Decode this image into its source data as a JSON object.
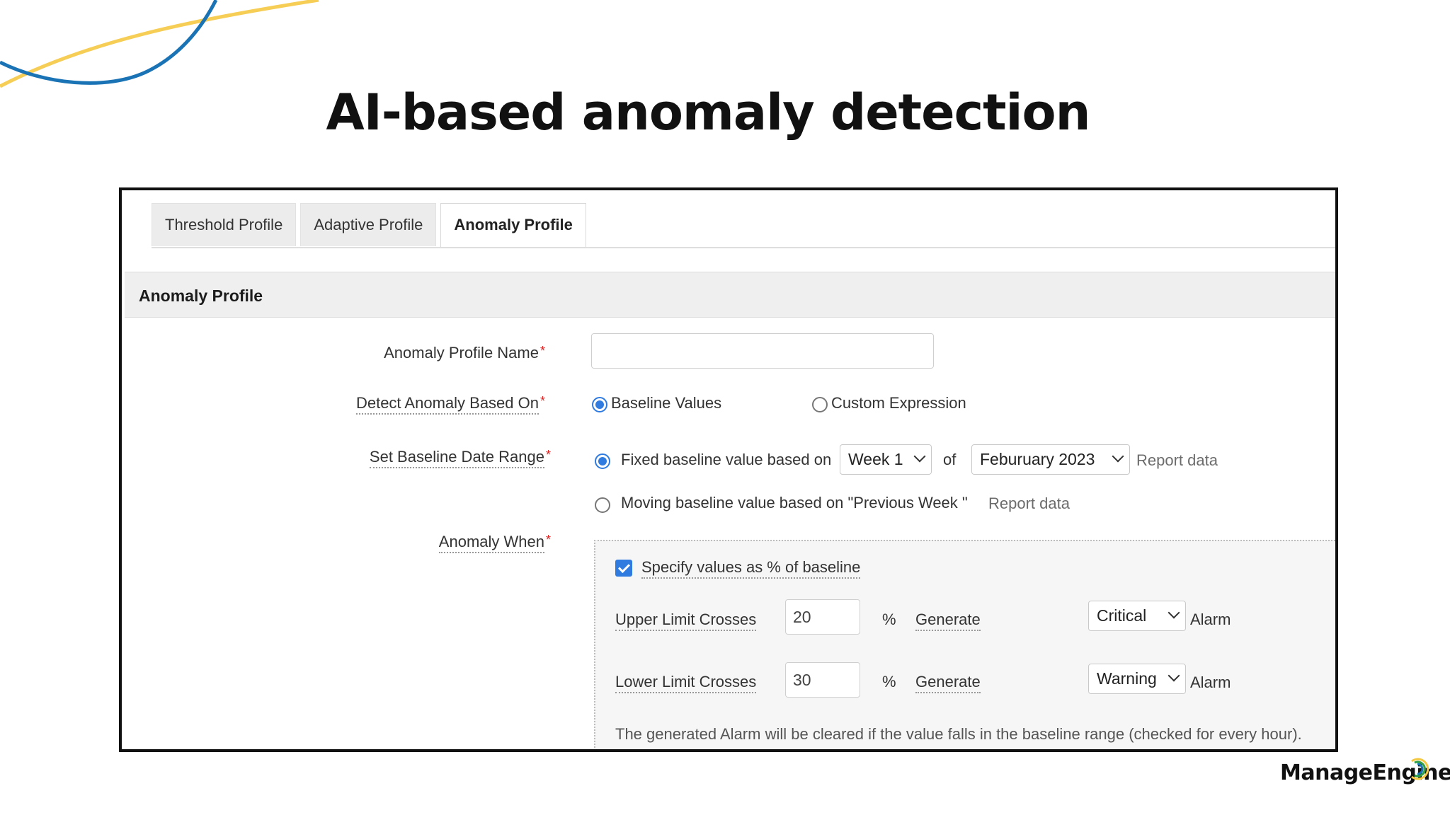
{
  "slide": {
    "title": "AI-based anomaly detection",
    "brand": "ManageEngine",
    "deco_colors": {
      "blue": "#1a73b5",
      "yellow": "#f5c842"
    }
  },
  "tabs": [
    {
      "label": "Threshold Profile",
      "active": false
    },
    {
      "label": "Adaptive Profile",
      "active": false
    },
    {
      "label": "Anomaly Profile",
      "active": true
    }
  ],
  "section": {
    "title": "Anomaly Profile"
  },
  "form": {
    "profile_name": {
      "label": "Anomaly Profile Name",
      "required": "*",
      "value": "",
      "placeholder": ""
    },
    "detect_based_on": {
      "label": "Detect Anomaly Based On",
      "required": "*",
      "options": [
        {
          "label": "Baseline Values",
          "checked": true
        },
        {
          "label": "Custom Expression",
          "checked": false
        }
      ]
    },
    "baseline_range": {
      "label": "Set Baseline Date Range",
      "required": "*",
      "fixed": {
        "checked": true,
        "prefix": "Fixed baseline value based on",
        "week": "Week 1",
        "of": "of",
        "month": "Feburuary 2023",
        "link": "Report data"
      },
      "moving": {
        "checked": false,
        "text": "Moving baseline value based on \"Previous Week \"",
        "link": "Report data"
      }
    },
    "anomaly_when": {
      "label": "Anomaly When",
      "required": "*",
      "percent_checkbox": {
        "label": "Specify values as % of baseline",
        "checked": true
      },
      "upper": {
        "label": "Upper Limit Crosses",
        "value": "20",
        "unit": "%",
        "generate": "Generate",
        "severity": "Critical",
        "suffix": "Alarm"
      },
      "lower": {
        "label": "Lower Limit Crosses",
        "value": "30",
        "unit": "%",
        "generate": "Generate",
        "severity": "Warning",
        "suffix": "Alarm"
      },
      "note": "The generated Alarm will be cleared if the value falls in the baseline range (checked for every hour)."
    }
  },
  "colors": {
    "accent": "#2f7be0",
    "required": "#e02424",
    "border": "#111111"
  }
}
